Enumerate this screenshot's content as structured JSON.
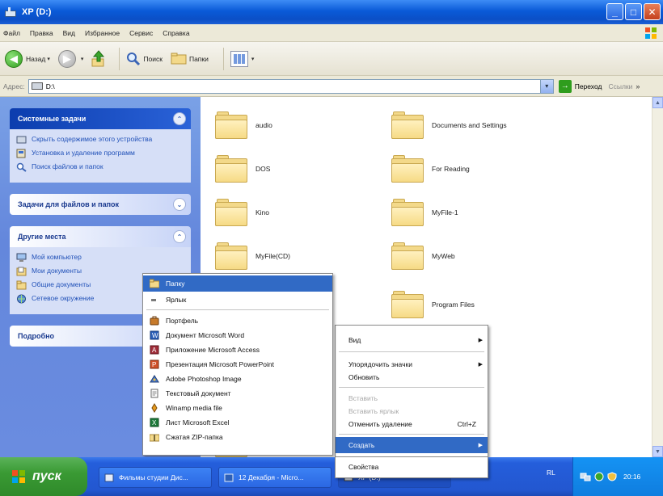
{
  "window": {
    "title": "XP (D:)",
    "minimize": "_",
    "maximize": "□",
    "close": "✕"
  },
  "menubar": [
    "Файл",
    "Правка",
    "Вид",
    "Избранное",
    "Сервис",
    "Справка"
  ],
  "toolbar": {
    "back_label": "Назад",
    "back_arrow": "◀",
    "forward_arrow": "▶",
    "dropdown": "▾",
    "search_label": "Поиск",
    "folders_label": "Папки"
  },
  "address": {
    "label": "Адрес:",
    "value": "D:\\",
    "go_label": "Переход",
    "links_label": "Ссылки",
    "go_arrow": "→",
    "dropdown": "▾",
    "more": "»"
  },
  "taskpane": {
    "system": {
      "title": "Системные задачи",
      "chevron": "⌃",
      "items": [
        "Скрыть содержимое этого устройства",
        "Установка и удаление программ",
        "Поиск файлов и папок"
      ]
    },
    "files": {
      "title": "Задачи для файлов и папок",
      "chevron": "⌄"
    },
    "places": {
      "title": "Другие места",
      "chevron": "⌃",
      "items": [
        "Мой компьютер",
        "Мои документы",
        "Общие документы",
        "Сетевое окружение"
      ]
    },
    "details": {
      "title": "Подробно"
    }
  },
  "folders": {
    "audio": "audio",
    "documents": "Documents and Settings",
    "dos": "DOS",
    "reading": "For Reading",
    "kino": "Kino",
    "myfile1": "MyFile-1",
    "myfilecd": "MyFile(CD)",
    "myweb": "MyWeb",
    "program_files": "Program Files"
  },
  "scroll": {
    "up": "▲",
    "down": "▼"
  },
  "context_menu": {
    "arrow": "▶",
    "view": "Вид",
    "arrange": "Упорядочить значки",
    "refresh": "Обновить",
    "paste": "Вставить",
    "paste_shortcut": "Вставить ярлык",
    "undo": "Отменить удаление",
    "undo_shortcut": "Ctrl+Z",
    "create": "Создать",
    "properties": "Свойства"
  },
  "create_submenu": {
    "folder": "Папку",
    "shortcut": "Ярлык",
    "briefcase": "Портфель",
    "word": "Документ Microsoft Word",
    "access": "Приложение Microsoft Access",
    "powerpoint": "Презентация Microsoft PowerPoint",
    "photoshop": "Adobe Photoshop Image",
    "text": "Текстовый документ",
    "winamp": "Winamp media file",
    "excel": "Лист Microsoft Excel",
    "zip": "Сжатая ZIP-папка"
  },
  "taskbar": {
    "start": "пуск",
    "tasks": [
      "Фильмы студии Дис...",
      "12 Декабря - Micro...",
      "XP (D:)"
    ],
    "lang": "RL",
    "clock": "20:16"
  },
  "colors": {
    "xp_blue": "#0a5ad8",
    "selection": "#316ac5",
    "taskpane": "#6487dc",
    "start_green": "#3a9a34",
    "link_blue": "#2151b8"
  }
}
